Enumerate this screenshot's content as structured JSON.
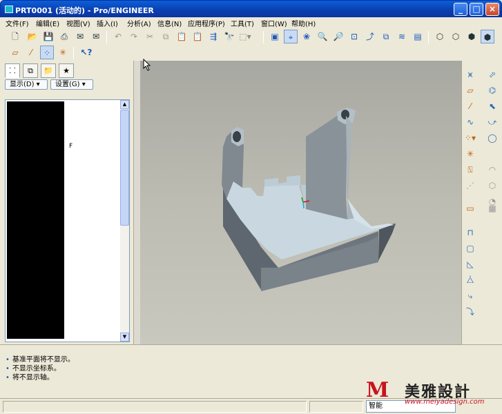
{
  "window": {
    "title": "PRT0001 (活动的) - Pro/ENGINEER",
    "minimize": "_",
    "maximize": "□",
    "close": "×"
  },
  "menu": {
    "items": [
      "文件(F)",
      "编辑(E)",
      "视图(V)",
      "插入(I)",
      "分析(A)",
      "信息(N)",
      "应用程序(P)",
      "工具(T)",
      "窗口(W)",
      "帮助(H)"
    ]
  },
  "toolbar": {
    "row1": [
      "new-icon",
      "open-icon",
      "save-icon",
      "print-icon",
      "email-icon",
      "email-link-icon",
      "undo-icon",
      "redo-icon",
      "cut-icon",
      "copy-icon",
      "paste-icon",
      "paste-special-icon",
      "regenerate-icon",
      "find-icon",
      "select-box-icon",
      "repaint-icon",
      "spin-center-icon",
      "orient-icon",
      "saved-views-icon",
      "zoom-in-icon",
      "zoom-out-icon",
      "refit-icon",
      "reorient-icon",
      "view-list-icon",
      "layers-icon",
      "view-manager-icon",
      "wireframe-icon",
      "hidden-line-icon",
      "no-hidden-icon",
      "shading-icon"
    ],
    "row2": [
      "datum-planes-icon",
      "datum-axes-icon",
      "datum-points-icon",
      "csys-icon",
      "context-help-icon"
    ]
  },
  "left_panel": {
    "tabs": [
      "model-tree-icon",
      "layers-tab-icon",
      "folder-browser-icon",
      "favorites-icon"
    ],
    "show_button": "显示(D) ▾",
    "settings_button": "设置(G) ▾",
    "tree_stray_text": "F"
  },
  "right_toolbar": {
    "icons": [
      "datum-plane-tool-icon",
      "datum-axis-tool-icon",
      "datum-curve-tool-icon",
      "datum-point-tool-icon",
      "csys-tool-icon",
      "analysis-tool-icon",
      "sketch-tool-icon",
      "hole-tool-icon",
      "shell-tool-icon",
      "rib-tool-icon",
      "draft-tool-icon",
      "round-tool-icon",
      "chamfer-tool-icon",
      "extrude-tool-icon",
      "revolve-tool-icon",
      "sweep-tool-icon",
      "blend-tool-icon",
      "mirror-tool-icon",
      "merge-tool-icon",
      "trim-tool-icon",
      "pattern-tool-icon"
    ]
  },
  "messages": [
    "基准平面将不显示。",
    "不显示坐标系。",
    "将不显示轴。"
  ],
  "status": {
    "filter_label": "智能"
  },
  "watermark": {
    "logo": "M",
    "name": "美雅設計",
    "url": "www.meiyadesign.com"
  },
  "colors": {
    "title_bar": "#0a4fc8",
    "viewport_bg": "#b4b4aa",
    "part_top": "#c9d7e0",
    "part_side": "#5e6670",
    "watermark_red": "#c8141e"
  }
}
